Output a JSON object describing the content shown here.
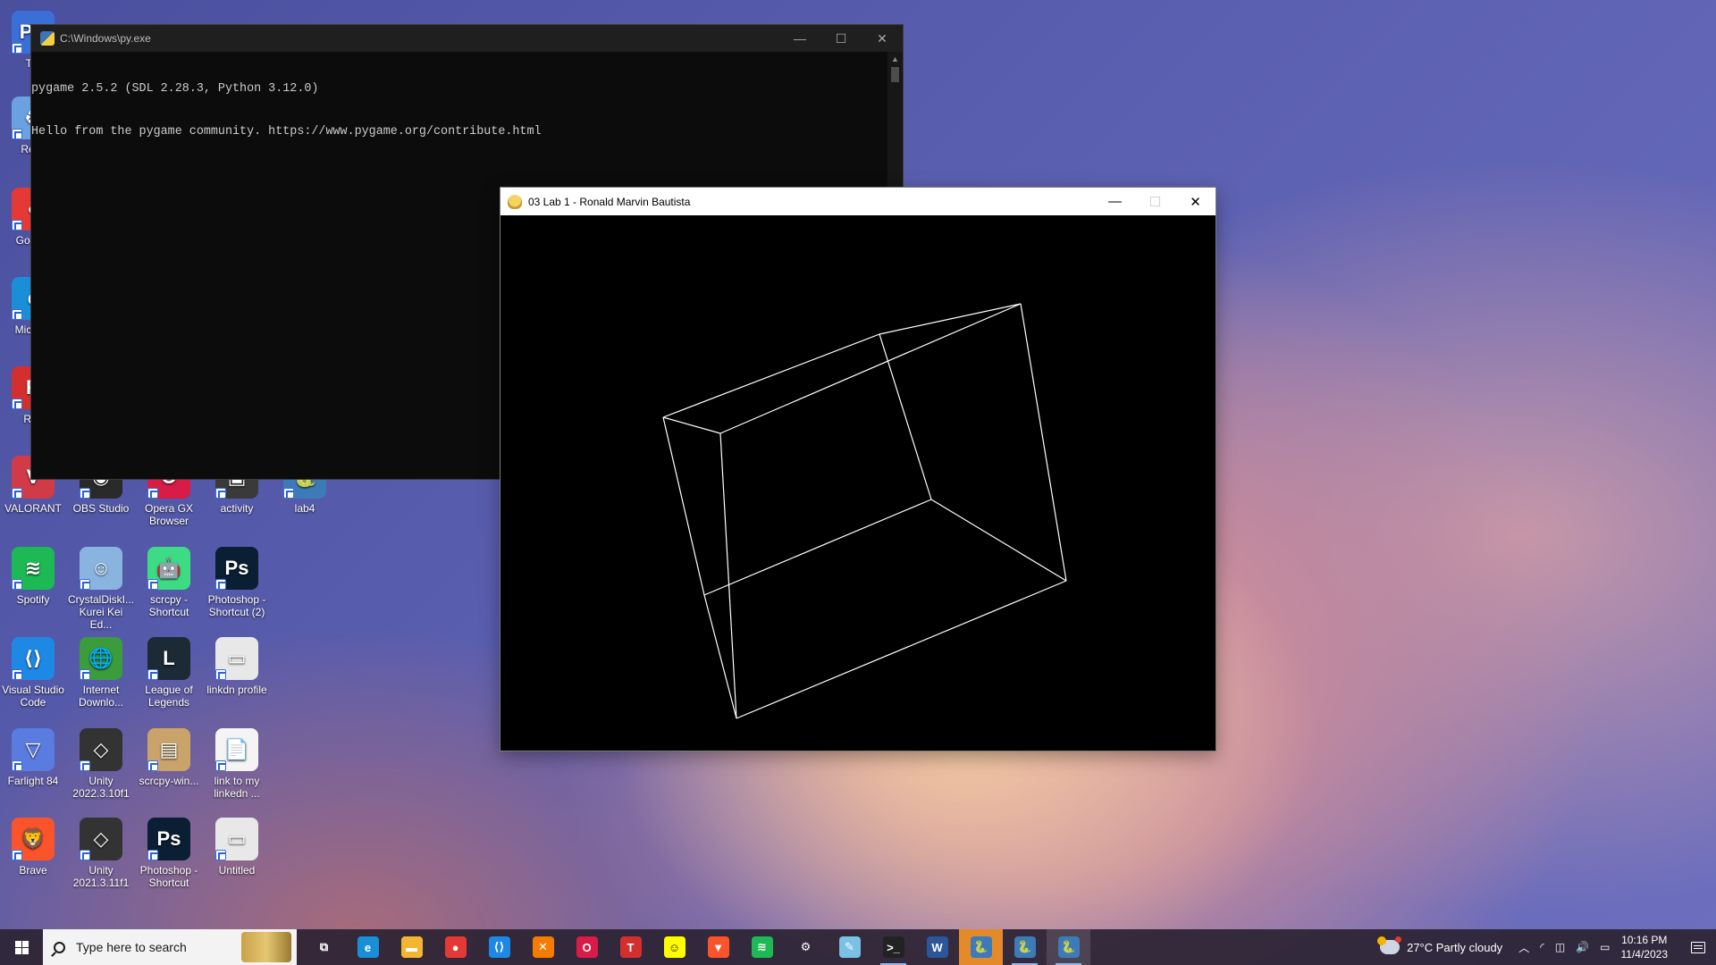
{
  "desktop": {
    "icons": [
      {
        "label": "Thi",
        "color": "#3b6fd8",
        "glyph": "PC"
      },
      {
        "label": "Recy",
        "color": "#6aa1e0",
        "glyph": "♻"
      },
      {
        "label": "Go Chr",
        "color": "#e53935",
        "glyph": "●"
      },
      {
        "label": "Micr Ed",
        "color": "#1a8fd8",
        "glyph": "e"
      },
      {
        "label": "Riot",
        "color": "#d32f2f",
        "glyph": "R"
      },
      {
        "label": "VALORANT",
        "color": "#d13a47",
        "glyph": "V"
      },
      {
        "label": "OBS Studio",
        "color": "#2a2a2a",
        "glyph": "◉"
      },
      {
        "label": "Opera GX Browser",
        "color": "#d81b47",
        "glyph": "O"
      },
      {
        "label": "activity",
        "color": "#3a3a3a",
        "glyph": "▣"
      },
      {
        "label": "lab4",
        "color": "#3d7ab8",
        "glyph": "🐍"
      },
      {
        "label": "Spotify",
        "color": "#1db954",
        "glyph": "≋"
      },
      {
        "label": "CrystalDiskI... Kurei Kei Ed...",
        "color": "#8ab4e0",
        "glyph": "☺"
      },
      {
        "label": "scrcpy - Shortcut",
        "color": "#3ddc84",
        "glyph": "🤖"
      },
      {
        "label": "Photoshop - Shortcut (2)",
        "color": "#0a1f33",
        "glyph": "Ps"
      },
      {
        "label": "Visual Studio Code",
        "color": "#1e88e5",
        "glyph": "⟨⟩"
      },
      {
        "label": "Internet Downlo...",
        "color": "#3b9c3b",
        "glyph": "🌐"
      },
      {
        "label": "League of Legends",
        "color": "#1c2a36",
        "glyph": "L"
      },
      {
        "label": "linkdn profile",
        "color": "#e8e8e8",
        "glyph": "▭"
      },
      {
        "label": "Farlight 84",
        "color": "#5a7be0",
        "glyph": "▽"
      },
      {
        "label": "Unity 2022.3.10f1",
        "color": "#333333",
        "glyph": "◇"
      },
      {
        "label": "scrcpy-win...",
        "color": "#c9a36a",
        "glyph": "▤"
      },
      {
        "label": "link to my linkedn ...",
        "color": "#f4f4f4",
        "glyph": "📄"
      },
      {
        "label": "Brave",
        "color": "#fb542b",
        "glyph": "🦁"
      },
      {
        "label": "Unity 2021.3.11f1",
        "color": "#333333",
        "glyph": "◇"
      },
      {
        "label": "Photoshop - Shortcut",
        "color": "#0a1f33",
        "glyph": "Ps"
      },
      {
        "label": "Untitled",
        "color": "#e8e8e8",
        "glyph": "▭"
      }
    ]
  },
  "console": {
    "title": "C:\\Windows\\py.exe",
    "lines": [
      "pygame 2.5.2 (SDL 2.28.3, Python 3.12.0)",
      "Hello from the pygame community. https://www.pygame.org/contribute.html"
    ],
    "minimize": "—",
    "maximize": "☐",
    "close": "✕",
    "scroll_up": "▲"
  },
  "pygame_window": {
    "title": "03 Lab 1 - Ronald Marvin Bautista",
    "minimize": "—",
    "maximize": "☐",
    "close": "✕",
    "line_color": "#ffffff",
    "background": "#000000"
  },
  "taskbar": {
    "search_placeholder": "Type here to search",
    "apps": [
      {
        "name": "task-view",
        "glyph": "⧉",
        "color": "transparent"
      },
      {
        "name": "edge",
        "glyph": "e",
        "color": "#1a8fd8"
      },
      {
        "name": "file-explorer",
        "glyph": "▬",
        "color": "#f2b631"
      },
      {
        "name": "chrome",
        "glyph": "●",
        "color": "#e53935"
      },
      {
        "name": "vscode",
        "glyph": "⟨⟩",
        "color": "#1e88e5"
      },
      {
        "name": "xampp",
        "glyph": "✕",
        "color": "#f57c00"
      },
      {
        "name": "opera",
        "glyph": "O",
        "color": "#d81b47"
      },
      {
        "name": "app-t",
        "glyph": "T",
        "color": "#d32f2f"
      },
      {
        "name": "snapchat",
        "glyph": "☺",
        "color": "#fffc00"
      },
      {
        "name": "brave",
        "glyph": "▼",
        "color": "#fb542b"
      },
      {
        "name": "spotify",
        "glyph": "≋",
        "color": "#1db954"
      },
      {
        "name": "settings",
        "glyph": "⚙",
        "color": "transparent"
      },
      {
        "name": "notepad",
        "glyph": "✎",
        "color": "#7ac1e4"
      },
      {
        "name": "terminal",
        "glyph": ">_",
        "color": "#222222"
      },
      {
        "name": "word",
        "glyph": "W",
        "color": "#2b579a"
      },
      {
        "name": "python-idle",
        "glyph": "🐍",
        "color": "#3d7ab8"
      },
      {
        "name": "python-launcher",
        "glyph": "🐍",
        "color": "#3d7ab8"
      },
      {
        "name": "pygame-app",
        "glyph": "🐍",
        "color": "#3d7ab8"
      }
    ],
    "weather": "27°C  Partly cloudy",
    "time": "10:16 PM",
    "date": "11/4/2023"
  }
}
